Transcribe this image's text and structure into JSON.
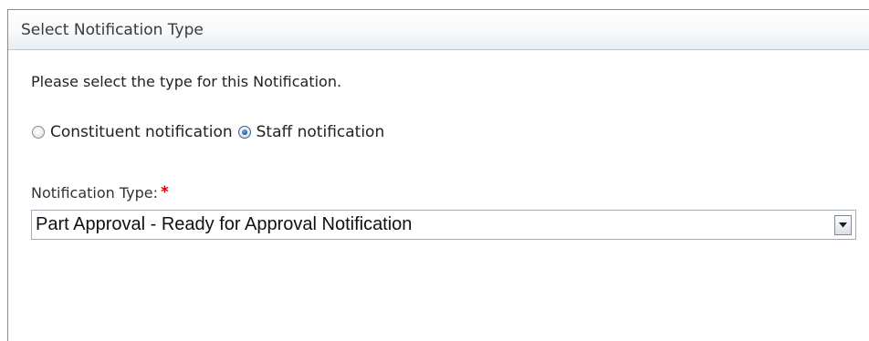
{
  "panel": {
    "title": "Select Notification Type"
  },
  "form": {
    "instructions": "Please select the type for this Notification.",
    "radio_options": [
      {
        "label": "Constituent notification",
        "checked": false
      },
      {
        "label": "Staff notification",
        "checked": true
      }
    ],
    "notification_type": {
      "label": "Notification Type:",
      "required_marker": "*",
      "selected_value": "Part Approval - Ready for Approval Notification",
      "icon": "chevron-down-icon"
    }
  },
  "colors": {
    "required": "#d40000",
    "radio_selected": "#1f5fa8"
  }
}
